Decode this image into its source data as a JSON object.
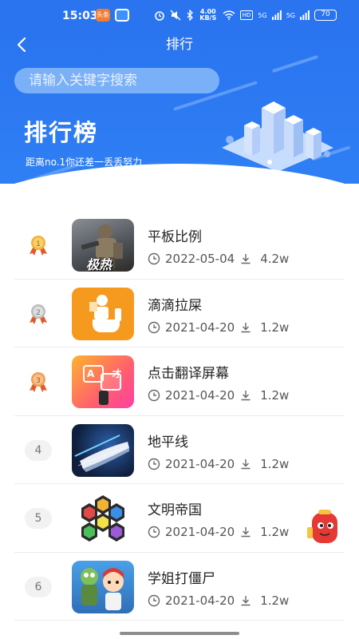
{
  "status_bar": {
    "time": "15:03",
    "net_speed": "4.00 KB/S",
    "hd": "HD",
    "sig1": "5G",
    "sig2": "5G",
    "battery": "70",
    "app_badge1": "头条"
  },
  "header": {
    "title": "排行",
    "search_placeholder": "请输入关键字搜索"
  },
  "hero": {
    "title": "排行榜",
    "subtitle": "距离no.1你还差一丢丢努力"
  },
  "list": [
    {
      "rank": "1",
      "name": "平板比例",
      "date": "2022-05-04",
      "downloads": "4.2w",
      "thumb_text": "极热"
    },
    {
      "rank": "2",
      "name": "滴滴拉屎",
      "date": "2021-04-20",
      "downloads": "1.2w"
    },
    {
      "rank": "3",
      "name": "点击翻译屏幕",
      "date": "2021-04-20",
      "downloads": "1.2w",
      "thumb_text": "A 才"
    },
    {
      "rank": "4",
      "name": "地平线",
      "date": "2021-04-20",
      "downloads": "1.2w"
    },
    {
      "rank": "5",
      "name": "文明帝国",
      "date": "2021-04-20",
      "downloads": "1.2w"
    },
    {
      "rank": "6",
      "name": "学姐打僵尸",
      "date": "2021-04-20",
      "downloads": "1.2w"
    }
  ],
  "colors": {
    "primary": "#2a74f0",
    "gold": "#f3b23a",
    "silver": "#c9c9c9",
    "bronze": "#f0a052"
  }
}
